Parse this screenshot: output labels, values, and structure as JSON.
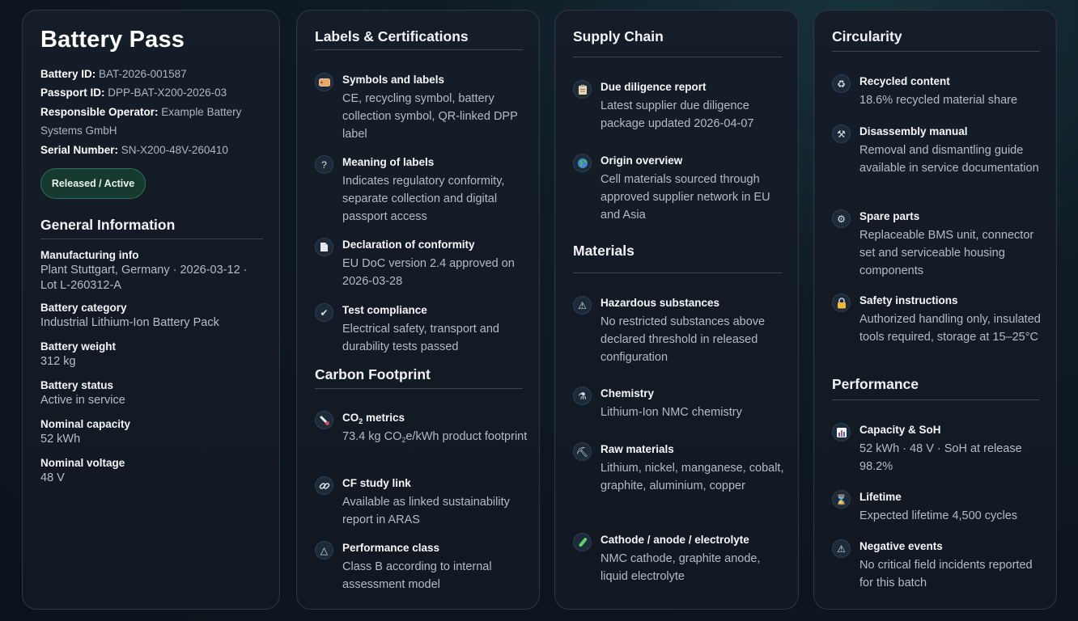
{
  "pass": {
    "title": "Battery Pass",
    "battery_id_label": "Battery ID:",
    "battery_id": "BAT-2026-001587",
    "passport_id_label": "Passport ID:",
    "passport_id": "DPP-BAT-X200-2026-03",
    "operator_label": "Responsible Operator:",
    "operator": "Example Battery Systems GmbH",
    "serial_label": "Serial Number:",
    "serial": "SN-X200-48V-260410",
    "status_badge": "Released / Active",
    "general_title": "General Information",
    "general": [
      {
        "label": "Manufacturing info",
        "value": "Plant Stuttgart, Germany · 2026-03-12 · Lot L-260312-A"
      },
      {
        "label": "Battery category",
        "value": "Industrial Lithium-Ion Battery Pack"
      },
      {
        "label": "Battery weight",
        "value": "312 kg"
      },
      {
        "label": "Battery status",
        "value": "Active in service"
      },
      {
        "label": "Nominal capacity",
        "value": "52 kWh"
      },
      {
        "label": "Nominal voltage",
        "value": "48 V"
      }
    ]
  },
  "labels": {
    "title": "Labels & Certifications",
    "items": [
      {
        "icon": "label-tag-icon",
        "label": "Symbols and labels",
        "value": "CE, recycling symbol, battery collection symbol, QR-linked DPP label"
      },
      {
        "icon": "question-icon",
        "label": "Meaning of labels",
        "value": "Indicates regulatory conformity, separate collection and digital passport access"
      },
      {
        "icon": "document-icon",
        "label": "Declaration of conformity",
        "value": "EU DoC version 2.4 approved on 2026-03-28"
      },
      {
        "icon": "checkmark-icon",
        "label": "Test compliance",
        "value": "Electrical safety, transport and durability tests passed"
      }
    ]
  },
  "carbon": {
    "title": "Carbon Footprint",
    "co2_label_pre": "CO",
    "co2_label_sub": "2",
    "co2_label_post": " metrics",
    "co2_value_pre": "73.4 kg CO",
    "co2_value_sub": "2",
    "co2_value_post": "e/kWh product footprint",
    "items": [
      {
        "icon": "link-icon",
        "label": "CF study link",
        "value": "Available as linked sustainability report in ARAS"
      },
      {
        "icon": "warning-triangle-icon",
        "label": "Performance class",
        "value": "Class B according to internal assessment model"
      }
    ]
  },
  "supply": {
    "title": "Supply Chain",
    "items": [
      {
        "icon": "clipboard-icon",
        "label": "Due diligence report",
        "value": "Latest supplier due diligence package updated 2026-04-07"
      },
      {
        "icon": "globe-icon",
        "label": "Origin overview",
        "value": "Cell materials sourced through approved supplier network in EU and Asia"
      }
    ]
  },
  "materials": {
    "title": "Materials",
    "items": [
      {
        "icon": "hazard-icon",
        "label": "Hazardous substances",
        "value": "No restricted substances above declared threshold in released configuration"
      },
      {
        "icon": "flask-icon",
        "label": "Chemistry",
        "value": "Lithium-Ion NMC chemistry"
      },
      {
        "icon": "pickaxe-icon",
        "label": "Raw materials",
        "value": "Lithium, nickel, manganese, cobalt, graphite, aluminium, copper"
      },
      {
        "icon": "test-tube-icon",
        "label": "Cathode / anode / electrolyte",
        "value": "NMC cathode, graphite anode, liquid electrolyte"
      }
    ]
  },
  "circularity": {
    "title": "Circularity",
    "items": [
      {
        "icon": "recycle-icon",
        "label": "Recycled content",
        "value": "18.6% recycled material share"
      },
      {
        "icon": "tools-icon",
        "label": "Disassembly manual",
        "value": "Removal and dismantling guide available in service documentation"
      },
      {
        "icon": "gear-icon",
        "label": "Spare parts",
        "value": "Replaceable BMS unit, connector set and serviceable housing components"
      },
      {
        "icon": "lock-icon",
        "label": "Safety instructions",
        "value": "Authorized handling only, insulated tools required, storage at 15–25°C"
      }
    ]
  },
  "performance": {
    "title": "Performance",
    "items": [
      {
        "icon": "bar-chart-icon",
        "label": "Capacity & SoH",
        "value": "52 kWh · 48 V · SoH at release 98.2%"
      },
      {
        "icon": "hourglass-icon",
        "label": "Lifetime",
        "value": "Expected lifetime 4,500 cycles"
      },
      {
        "icon": "warning-icon",
        "label": "Negative events",
        "value": "No critical field incidents reported for this batch"
      }
    ]
  }
}
